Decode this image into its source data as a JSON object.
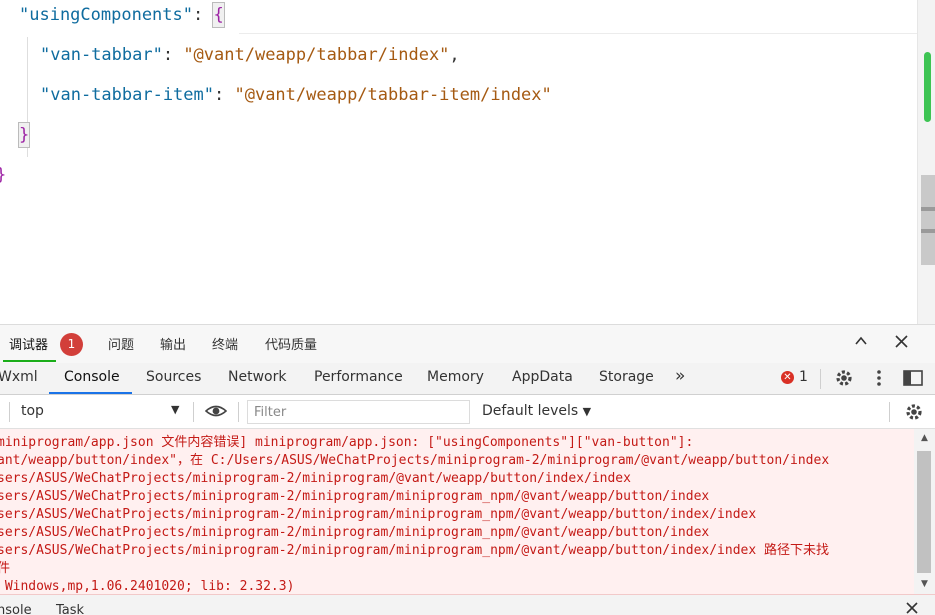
{
  "editor": {
    "line1": {
      "key": "\"usingComponents\"",
      "colon": ": ",
      "brace": "{"
    },
    "line2": {
      "key": "\"van-tabbar\"",
      "colon": ": ",
      "value": "\"@vant/weapp/tabbar/index\"",
      "comma": ","
    },
    "line3": {
      "key": "\"van-tabbar-item\"",
      "colon": ": ",
      "value": "\"@vant/weapp/tabbar-item/index\""
    },
    "line4": {
      "brace": "}"
    },
    "line5": {
      "brace": "}"
    }
  },
  "panel_tabs": {
    "debugger": "调试器",
    "badge": "1",
    "problems": "问题",
    "output": "输出",
    "terminal": "终端",
    "quality": "代码质量",
    "collapse_icon": "chevron-up-icon",
    "close_icon": "close-icon"
  },
  "dev_tabs": {
    "items": [
      "Wxml",
      "Console",
      "Sources",
      "Network",
      "Performance",
      "Memory",
      "AppData",
      "Storage"
    ],
    "active": "Console",
    "more": "»",
    "error_count": "1"
  },
  "console_toolbar": {
    "context": "top",
    "filter_placeholder": "Filter",
    "levels": "Default levels"
  },
  "console_lines": [
    "miniprogram/app.json 文件内容错误] miniprogram/app.json: [\"usingComponents\"][\"van-button\"]:",
    "ant/weapp/button/index\"，在 C:/Users/ASUS/WeChatProjects/miniprogram-2/miniprogram/@vant/weapp/button/index",
    "sers/ASUS/WeChatProjects/miniprogram-2/miniprogram/@vant/weapp/button/index/index",
    "sers/ASUS/WeChatProjects/miniprogram-2/miniprogram/miniprogram_npm/@vant/weapp/button/index",
    "sers/ASUS/WeChatProjects/miniprogram-2/miniprogram/miniprogram_npm/@vant/weapp/button/index/index",
    "sers/ASUS/WeChatProjects/miniprogram-2/miniprogram/miniprogram_npm/@vant/weapp/button/index",
    "sers/ASUS/WeChatProjects/miniprogram-2/miniprogram/miniprogram_npm/@vant/weapp/button/index/index 路径下未找",
    "件",
    " Windows,mp,1.06.2401020; lib: 2.32.3)"
  ],
  "drawer": {
    "console_tab": "nsole",
    "task_tab": "Task"
  },
  "colors": {
    "error_red": "#c41a16",
    "badge_red": "#d23f3a",
    "active_green": "#1aad19",
    "active_blue": "#1a73e8",
    "json_key": "#0f6c9f",
    "json_string": "#a55a12",
    "json_brace": "#9c22a4"
  }
}
